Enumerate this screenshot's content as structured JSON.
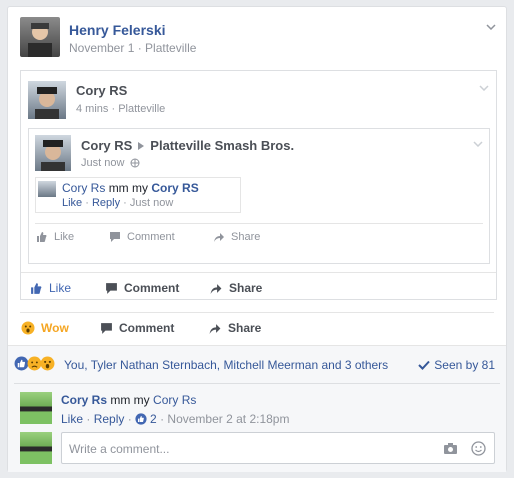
{
  "author": {
    "name": "Henry Felerski",
    "date": "November 1",
    "location": "Platteville"
  },
  "shared_post": {
    "author": "Cory RS",
    "time": "4 mins",
    "location": "Platteville",
    "inner_post": {
      "author": "Cory RS",
      "group": "Platteville Smash Bros.",
      "time": "Just now",
      "comment": {
        "author": "Cory Rs",
        "text": "mm my",
        "mention": "Cory RS",
        "like": "Like",
        "reply": "Reply",
        "time": "Just now"
      },
      "actions": {
        "like": "Like",
        "comment": "Comment",
        "share": "Share"
      }
    },
    "actions": {
      "like": "Like",
      "comment": "Comment",
      "share": "Share"
    }
  },
  "actions": {
    "reaction": "Wow",
    "comment": "Comment",
    "share": "Share"
  },
  "reactions": {
    "summary": "You, Tyler Nathan Sternbach, Mitchell Meerman and 3 others",
    "seen": "Seen by 81"
  },
  "comment": {
    "author": "Cory Rs",
    "text": "mm my",
    "mention": "Cory Rs",
    "like": "Like",
    "reply": "Reply",
    "like_count": "2",
    "time": "November 2 at 2:18pm"
  },
  "composer": {
    "placeholder": "Write a comment..."
  },
  "colors": {
    "link": "#365899",
    "wow": "#f5a623",
    "like_blue": "#4267b2",
    "meta": "#90949c"
  }
}
